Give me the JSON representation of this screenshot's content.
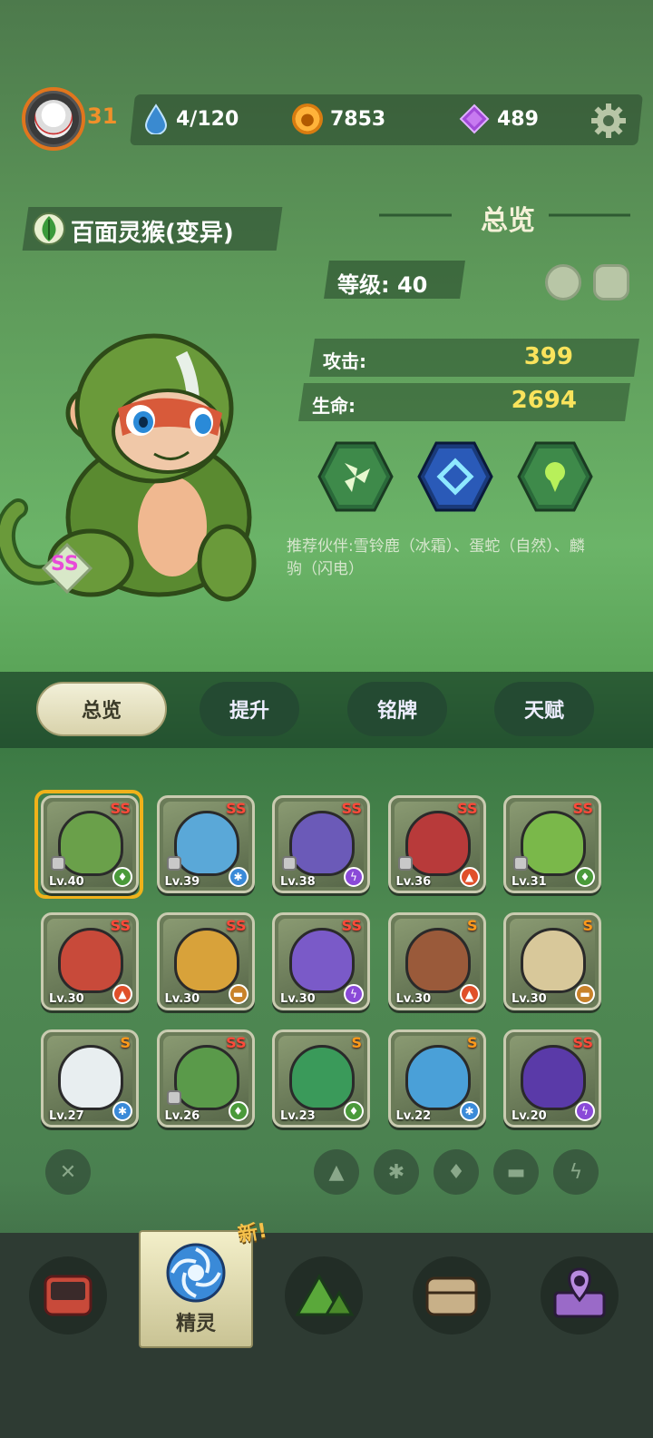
{
  "header": {
    "player_level": "31",
    "stamina": "4/120",
    "coins": "7853",
    "gems": "489"
  },
  "spirit": {
    "name": "百面灵猴(变异)",
    "rank": "SS",
    "overview_title": "总览",
    "level_label": "等级: 40",
    "attack_label": "攻击:",
    "attack_value": "399",
    "hp_label": "生命:",
    "hp_value": "2694",
    "recommend": "推荐伙伴:雪铃鹿（冰霜）、蛋蛇（自然）、麟驹（闪电）"
  },
  "tabs": [
    "总览",
    "提升",
    "铭牌",
    "天赋"
  ],
  "cards": [
    {
      "lv": "Lv.40",
      "rank": "SS",
      "element": "nature",
      "color": "#6aa04a",
      "locked": true
    },
    {
      "lv": "Lv.39",
      "rank": "SS",
      "element": "ice",
      "color": "#5aa8d8",
      "locked": true
    },
    {
      "lv": "Lv.38",
      "rank": "SS",
      "element": "lightning",
      "color": "#6b5ab8",
      "locked": true
    },
    {
      "lv": "Lv.36",
      "rank": "SS",
      "element": "fire",
      "color": "#b83a3a",
      "locked": true
    },
    {
      "lv": "Lv.31",
      "rank": "SS",
      "element": "nature",
      "color": "#7ab84a",
      "locked": true
    },
    {
      "lv": "Lv.30",
      "rank": "SS",
      "element": "fire",
      "color": "#c84a3a",
      "locked": false
    },
    {
      "lv": "Lv.30",
      "rank": "SS",
      "element": "earth",
      "color": "#d8a23a",
      "locked": false
    },
    {
      "lv": "Lv.30",
      "rank": "SS",
      "element": "lightning",
      "color": "#7a5ac8",
      "locked": false
    },
    {
      "lv": "Lv.30",
      "rank": "S",
      "element": "fire",
      "color": "#9a5a3a",
      "locked": false
    },
    {
      "lv": "Lv.30",
      "rank": "S",
      "element": "earth",
      "color": "#d8c89a",
      "locked": false
    },
    {
      "lv": "Lv.27",
      "rank": "S",
      "element": "ice",
      "color": "#e8eef0",
      "locked": false
    },
    {
      "lv": "Lv.26",
      "rank": "SS",
      "element": "nature",
      "color": "#5a9a4a",
      "locked": true
    },
    {
      "lv": "Lv.23",
      "rank": "S",
      "element": "nature",
      "color": "#3a9a5a",
      "locked": false
    },
    {
      "lv": "Lv.22",
      "rank": "S",
      "element": "ice",
      "color": "#4aa0d8",
      "locked": false
    },
    {
      "lv": "Lv.20",
      "rank": "SS",
      "element": "lightning",
      "color": "#5a3aa8",
      "locked": false
    }
  ],
  "nav": {
    "active_label": "精灵",
    "new_badge": "新!"
  }
}
